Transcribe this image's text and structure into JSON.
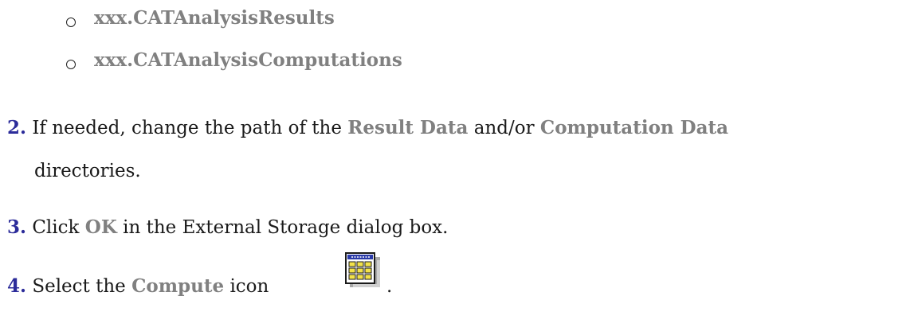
{
  "bullets": [
    {
      "text": "xxx.CATAnalysisResults"
    },
    {
      "text": "xxx.CATAnalysisComputations"
    }
  ],
  "steps": [
    {
      "number": "2.",
      "text_before": "If needed, change the path of the",
      "highlight1": "Result Data",
      "text_middle": "and/or",
      "highlight2": "Computation Data",
      "continuation": "directories."
    },
    {
      "number": "3.",
      "text_before": "Click",
      "highlight": "OK",
      "text_after": "in the External Storage dialog box."
    },
    {
      "number": "4.",
      "text_before": "Select the",
      "highlight": "Compute",
      "text_after": "icon",
      "icon_name": "compute-icon",
      "end": "."
    }
  ]
}
